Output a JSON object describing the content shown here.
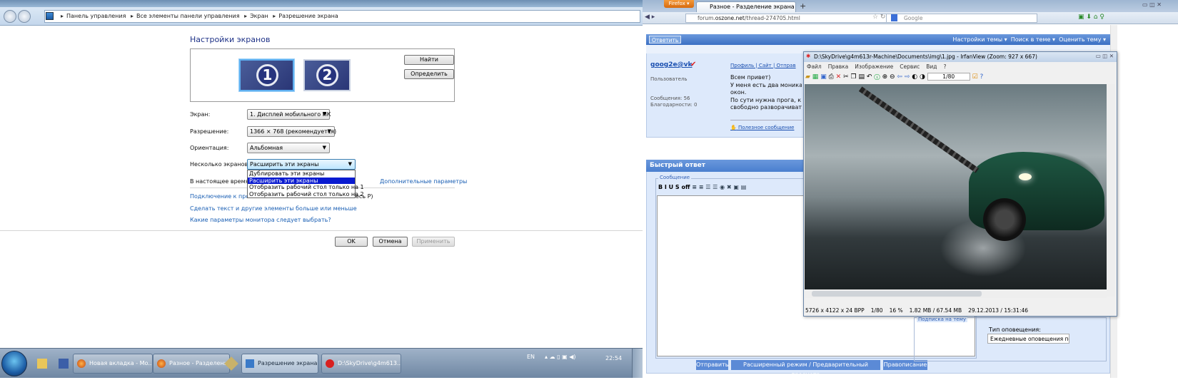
{
  "control_panel": {
    "breadcrumb": [
      "Панель управления",
      "Все элементы панели управления",
      "Экран",
      "Разрешение экрана"
    ],
    "heading": "Настройки экранов",
    "monitors": [
      "1",
      "2"
    ],
    "find_button": "Найти",
    "identify_button": "Определить",
    "rows": [
      {
        "label": "Экран:",
        "value": "1. Дисплей мобильного ПК"
      },
      {
        "label": "Разрешение:",
        "value": "1366 × 768 (рекомендуется)"
      },
      {
        "label": "Ориентация:",
        "value": "Альбомная"
      },
      {
        "label": "Несколько экранов:",
        "value": "Расширить эти экраны"
      }
    ],
    "dropdown_options": [
      "Дублировать эти экраны",
      "Расширить эти экраны",
      "Отобразить рабочий стол только на 1",
      "Отобразить рабочий стол только на 2"
    ],
    "current_text": "В настоящее время эт",
    "advanced_link": "Дополнительные параметры",
    "links": [
      "Подключение к проек",
      "есь P)",
      "Сделать текст и другие элементы больше или меньше",
      "Какие параметры монитора следует выбрать?"
    ],
    "ok": "OK",
    "cancel": "Отмена",
    "apply": "Применить"
  },
  "taskbar": {
    "items": [
      "Новая вкладка - Mo...",
      "Разное - Разделени...",
      "Разрешение экрана",
      "D:\\SkyDrive\\g4m613..."
    ],
    "lang": "EN",
    "clock": "22:54"
  },
  "firefox": {
    "menu_button": "Firefox ▾",
    "tab_title": "Разное - Разделение экрана",
    "url_prefix": "forum.",
    "url_domain": "oszone.net",
    "url_path": "/thread-274705.html",
    "search_placeholder": "Google",
    "forum": {
      "reply_button": "Ответить",
      "menu": [
        "Настройки темы ▾",
        "Поиск в теме ▾",
        "Оценить тему ▾"
      ],
      "username": "goog2e@vk",
      "role": "Пользователь",
      "messages": "Сообщения: 56",
      "thanks": "Благодарности: 0",
      "user_links": "Профиль | Сайт | Отправ",
      "post_lines": [
        "Всем привет)",
        "У меня есть два моника",
        "окон.",
        "По сути нужна прога, к",
        "свободно разворачиват"
      ],
      "useful": "Полезное сообщение",
      "quick_reply": "Быстрый ответ",
      "message_legend": "Сообщение",
      "editor_tools": "B I U S off",
      "send": "Отправить",
      "advanced": "Расширенный режим / Предварительный просмотр",
      "spelling": "Правописание",
      "subscription_legend": "Подписка на тему",
      "notify_label": "Тип оповещения:",
      "notify_value": "Ежедневные оповещения по e-mail"
    }
  },
  "irfanview": {
    "title": "D:\\SkyDrive\\g4m613r-Machine\\Documents\\img\\1.jpg - IrfanView (Zoom: 927 x 667)",
    "menu": [
      "Файл",
      "Правка",
      "Изображение",
      "Сервис",
      "Вид",
      "?"
    ],
    "page": "1/80",
    "status": [
      "5726 x 4122 x 24 BPP",
      "1/80",
      "16 %",
      "1.82 MB / 67.54 MB",
      "29.12.2013 / 15:31:46"
    ]
  }
}
